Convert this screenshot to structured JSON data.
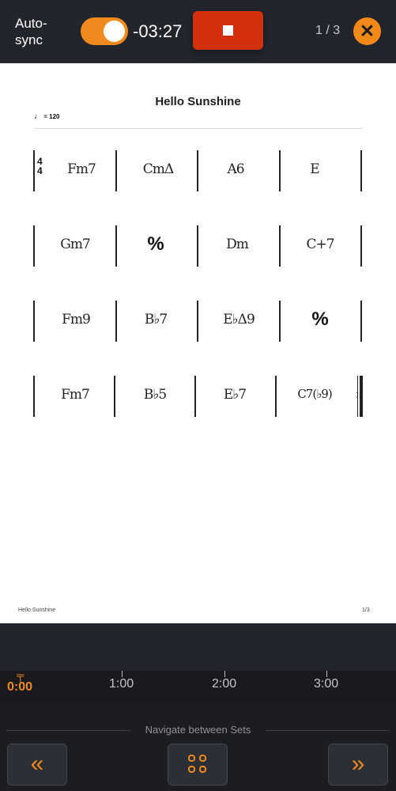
{
  "topbar": {
    "autosync_label": "Auto-\nsync",
    "timer": "-03:27",
    "page_counter": "1 / 3",
    "close_icon": "close-icon",
    "stop_icon": "stop-icon",
    "autosync_on": true
  },
  "sheet": {
    "title": "Hello Sunshine",
    "tempo": "= 120",
    "time_signature_top": "4",
    "time_signature_bottom": "4",
    "rows": [
      [
        "Fm7",
        "CmΔ",
        "A6",
        "E"
      ],
      [
        "Gm7",
        "%",
        "Dm",
        "C+7"
      ],
      [
        "Fm9",
        "B♭7",
        "E♭Δ9",
        "%"
      ],
      [
        "Fm7",
        "B♭5",
        "E♭7",
        "C7(♭9)"
      ]
    ],
    "footer_title": "Hello Sunshine",
    "footer_page": "1/3"
  },
  "timeline": {
    "current": "0:00",
    "labels": [
      "1:00",
      "2:00",
      "3:00"
    ]
  },
  "nav": {
    "label": "Navigate between Sets",
    "prev_icon": "double-chevron-left-icon",
    "grid_icon": "grid-icon",
    "next_icon": "double-chevron-right-icon"
  },
  "colors": {
    "accent": "#f08a1f",
    "stop": "#d2300c",
    "background": "#1b1d22"
  }
}
